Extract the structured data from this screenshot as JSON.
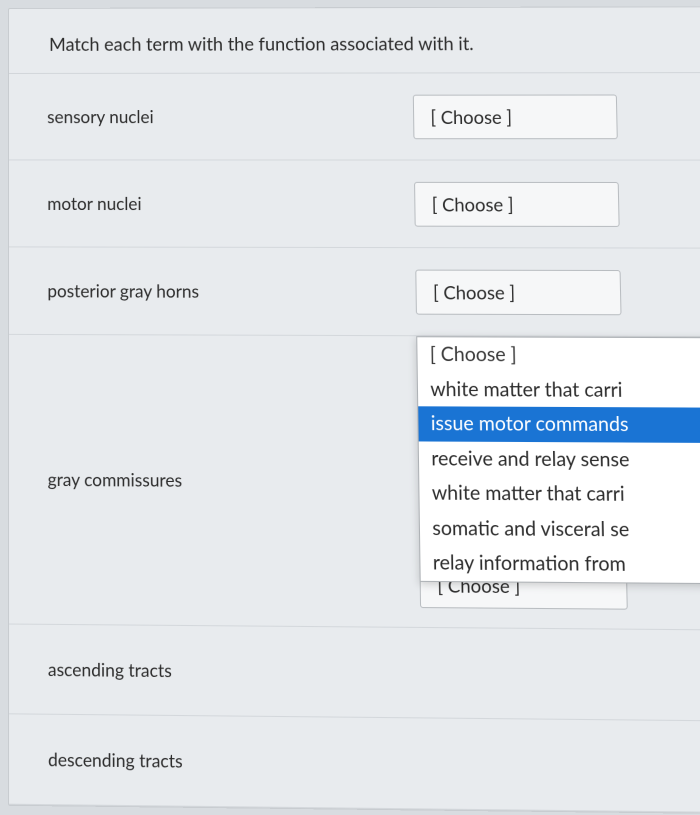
{
  "question": {
    "prompt": "Match each term with the function associated with it."
  },
  "placeholder": "[ Choose ]",
  "terms": [
    {
      "label": "sensory nuclei"
    },
    {
      "label": "motor nuclei"
    },
    {
      "label": "posterior gray horns"
    },
    {
      "label": "gray commissures"
    },
    {
      "label": "ascending tracts"
    },
    {
      "label": "descending tracts"
    }
  ],
  "dropdown": {
    "placeholder": "[ Choose ]",
    "options": [
      "white matter that carri",
      "issue motor commands",
      "receive and relay sense",
      "white matter that carri",
      "somatic and visceral se",
      "relay information from"
    ],
    "highlighted_index": 1
  }
}
